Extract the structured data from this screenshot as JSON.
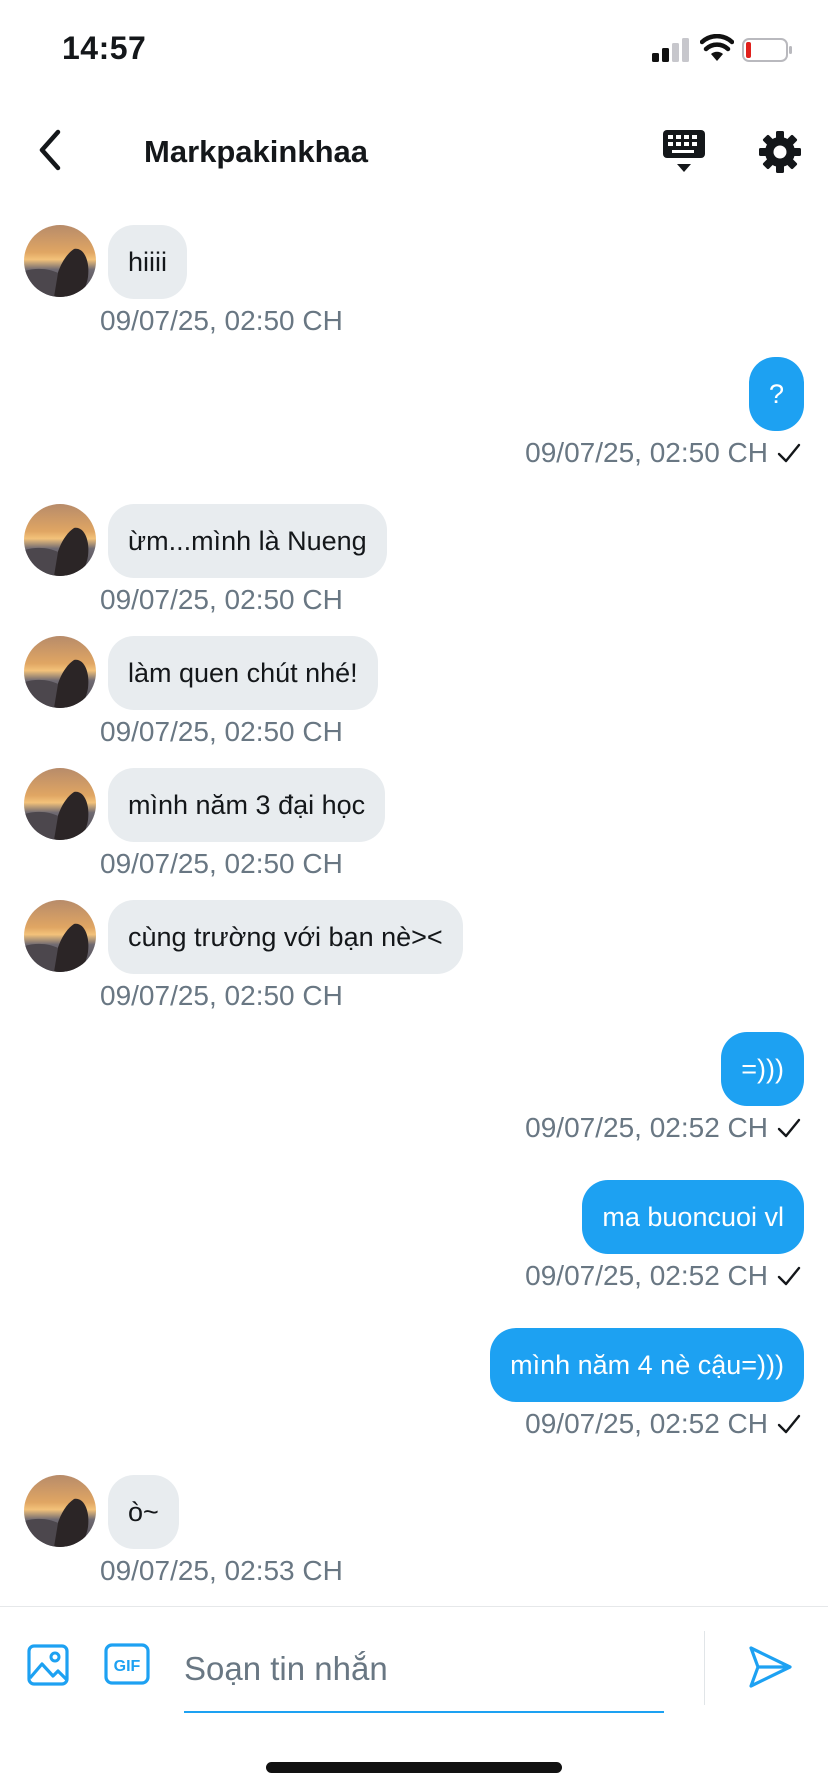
{
  "status_bar": {
    "time": "14:57",
    "icons": [
      "cellular-signal-icon",
      "wifi-icon",
      "battery-low-icon"
    ],
    "battery_color": "#e0201c"
  },
  "header": {
    "title": "Markpakinkhaa",
    "icons": [
      "back-chevron-icon",
      "keyboard-icon",
      "gear-icon"
    ]
  },
  "theme": {
    "accent": "#1da1f2",
    "incoming_bubble": "#e8ecef",
    "timestamp_color": "#697783"
  },
  "messages": [
    {
      "direction": "in",
      "text": "hiiii",
      "timestamp": "09/07/25, 02:50 CH"
    },
    {
      "direction": "out",
      "text": "?",
      "timestamp": "09/07/25, 02:50 CH",
      "read": true
    },
    {
      "direction": "in",
      "text": "ừm...mình là Nueng",
      "timestamp": "09/07/25, 02:50 CH"
    },
    {
      "direction": "in",
      "text": "làm quen chút nhé!",
      "timestamp": "09/07/25, 02:50 CH"
    },
    {
      "direction": "in",
      "text": "mình năm 3 đại học",
      "timestamp": "09/07/25, 02:50 CH"
    },
    {
      "direction": "in",
      "text": "cùng trường với bạn nè><",
      "timestamp": "09/07/25, 02:50 CH"
    },
    {
      "direction": "out",
      "text": "=)))",
      "timestamp": "09/07/25, 02:52 CH",
      "read": true
    },
    {
      "direction": "out",
      "text": "ma buoncuoi vl",
      "timestamp": "09/07/25, 02:52 CH",
      "read": true
    },
    {
      "direction": "out",
      "text": "mình năm 4 nè cậu=)))",
      "timestamp": "09/07/25, 02:52 CH",
      "read": true
    },
    {
      "direction": "in",
      "text": "ò~",
      "timestamp": "09/07/25, 02:53 CH"
    }
  ],
  "composer": {
    "placeholder": "Soạn tin nhắn",
    "value": "",
    "gif_label": "GIF",
    "icons": [
      "image-icon",
      "gif-icon",
      "send-icon"
    ]
  }
}
